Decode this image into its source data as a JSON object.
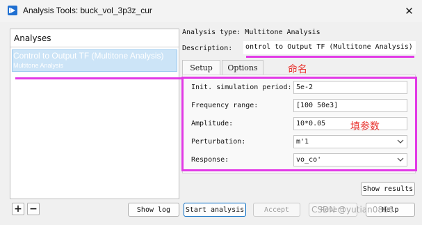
{
  "window": {
    "title": "Analysis Tools: buck_vol_3p3z_cur",
    "close_glyph": "✕"
  },
  "analyses": {
    "header": "Analyses",
    "items": [
      {
        "name": "Control to Output TF (Multitone Analysis)",
        "type": "Multitone Analysis"
      }
    ],
    "add_glyph": "+",
    "remove_glyph": "−"
  },
  "details": {
    "analysis_type_label": "Analysis type: Multitone Analysis",
    "description_label": "Description:",
    "description_value": "ontrol to Output TF (Multitone Analysis)"
  },
  "tabs": [
    {
      "label": "Setup",
      "active": true
    },
    {
      "label": "Options",
      "active": false
    }
  ],
  "setup": {
    "fields": [
      {
        "label": "Init. simulation period:",
        "value": "5e-2",
        "kind": "text"
      },
      {
        "label": "Frequency range:",
        "value": "[100 50e3]",
        "kind": "text"
      },
      {
        "label": "Amplitude:",
        "value": "10*0.05",
        "kind": "text"
      },
      {
        "label": "Perturbation:",
        "value": "m'1",
        "kind": "select"
      },
      {
        "label": "Response:",
        "value": "vo_co'",
        "kind": "select"
      }
    ]
  },
  "buttons": {
    "show_results": "Show results",
    "show_log": "Show log",
    "start_analysis": "Start analysis",
    "accept": "Accept",
    "revert": "Revert",
    "help": "Help"
  },
  "annotations": {
    "name_note": "命名",
    "params_note": "填参数",
    "color": "#e23ae6",
    "text_color": "#e8322d"
  },
  "watermark": "CSDN @yutian0806"
}
